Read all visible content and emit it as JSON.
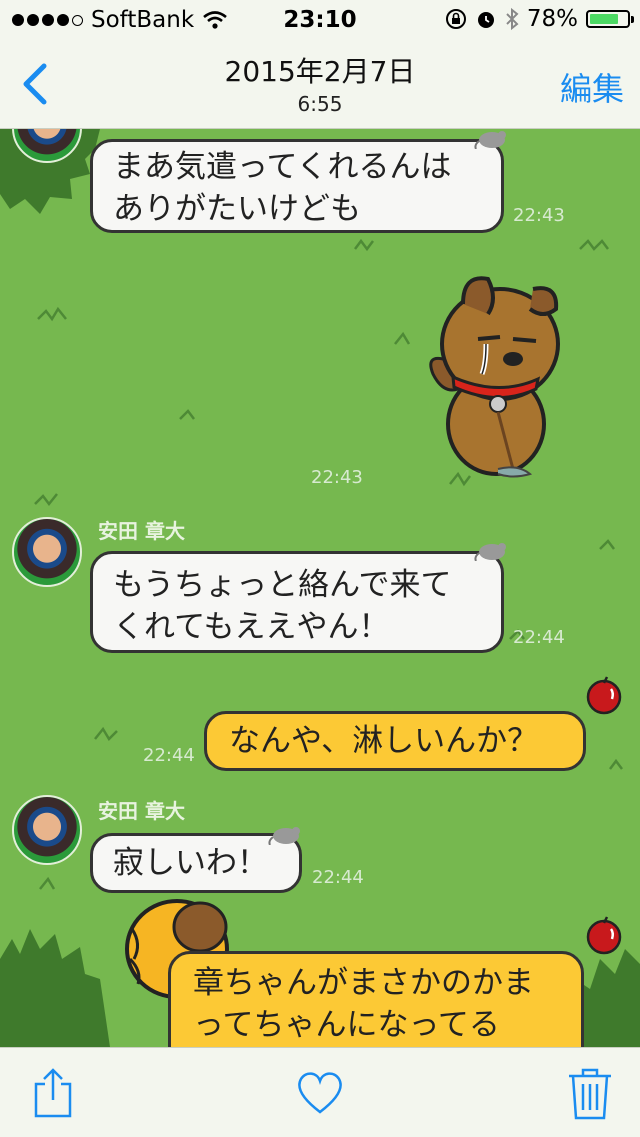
{
  "status_bar": {
    "carrier": "SoftBank",
    "time": "23:10",
    "battery": "78%",
    "battery_level": 0.78
  },
  "nav": {
    "title": "2015年2月7日",
    "subtitle": "6:55",
    "edit_label": "編集"
  },
  "messages": [
    {
      "text_lines": [
        "まあ気遣ってくれるんは",
        "ありがたいけども"
      ],
      "time": "22:43"
    },
    {
      "sticker": "crying-bear-sticker",
      "time": "22:43"
    },
    {
      "sender": "安田 章大",
      "text_lines": [
        "もうちょっと絡んで来て",
        "くれてもええやん！"
      ],
      "time": "22:44"
    },
    {
      "text": "なんや、淋しいんか？",
      "time": "22:44"
    },
    {
      "sender": "安田 章大",
      "text": "寂しいわ！",
      "time": "22:44"
    },
    {
      "text_lines": [
        "章ちゃんがまさかのかま",
        "ってちゃんになってる"
      ]
    }
  ],
  "toolbar": {
    "share_icon": "share-icon",
    "like_icon": "heart-icon",
    "delete_icon": "trash-icon"
  },
  "colors": {
    "accent": "#1a8cf0",
    "chat_bg": "#76b84f",
    "my_bubble": "#fcc935",
    "their_bubble": "#f7f7f5"
  }
}
